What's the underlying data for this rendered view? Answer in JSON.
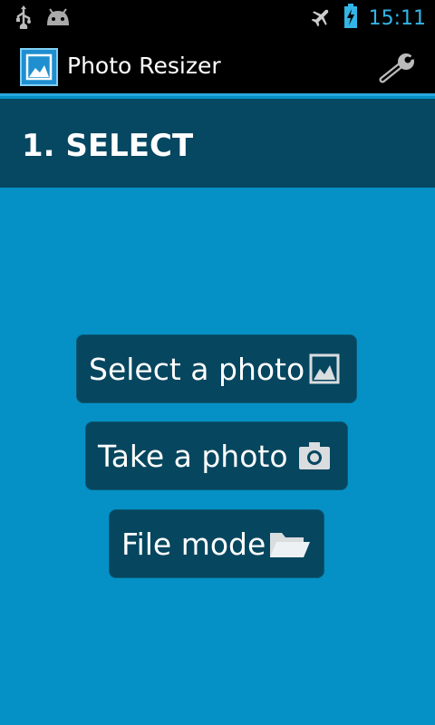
{
  "status_bar": {
    "time": "15:11",
    "icons": [
      "usb-icon",
      "android-icon",
      "airplane-mode-icon",
      "battery-charging-icon"
    ]
  },
  "action_bar": {
    "title": "Photo Resizer",
    "app_icon": "photo-icon",
    "settings_icon": "wrench-icon"
  },
  "step_header": {
    "title": "1. SELECT"
  },
  "actions": [
    {
      "label": "Select a photo",
      "icon": "image-icon"
    },
    {
      "label": "Take a photo",
      "icon": "camera-icon"
    },
    {
      "label": "File mode",
      "icon": "folder-icon"
    }
  ],
  "colors": {
    "background": "#0591c6",
    "header": "#064761",
    "button": "#06465f",
    "accent": "#33b5e5"
  }
}
